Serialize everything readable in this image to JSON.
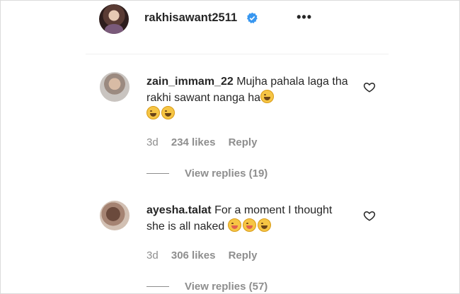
{
  "header": {
    "username": "rakhisawant2511",
    "verified_icon": "verified-badge-icon",
    "more_icon": "more-options-icon",
    "more_glyph": "•••"
  },
  "comments": [
    {
      "username": "zain_immam_22",
      "text": "Mujha pahala laga tha rakhi sawant nanga ha",
      "emojis": [
        "laughing-emoji",
        "laughing-emoji",
        "laughing-emoji"
      ],
      "time": "3d",
      "likes": "234 likes",
      "reply": "Reply",
      "view_replies": "View replies (19)"
    },
    {
      "username": "ayesha.talat",
      "text": "For a moment I thought she is all naked",
      "emojis": [
        "squinting-tongue-emoji",
        "squinting-tongue-emoji",
        "sweat-smile-emoji"
      ],
      "time": "3d",
      "likes": "306 likes",
      "reply": "Reply",
      "view_replies": "View replies (57)"
    }
  ],
  "colors": {
    "text": "#262626",
    "muted": "#8e8e8e",
    "verified": "#3897f0",
    "divider": "#efefef"
  }
}
